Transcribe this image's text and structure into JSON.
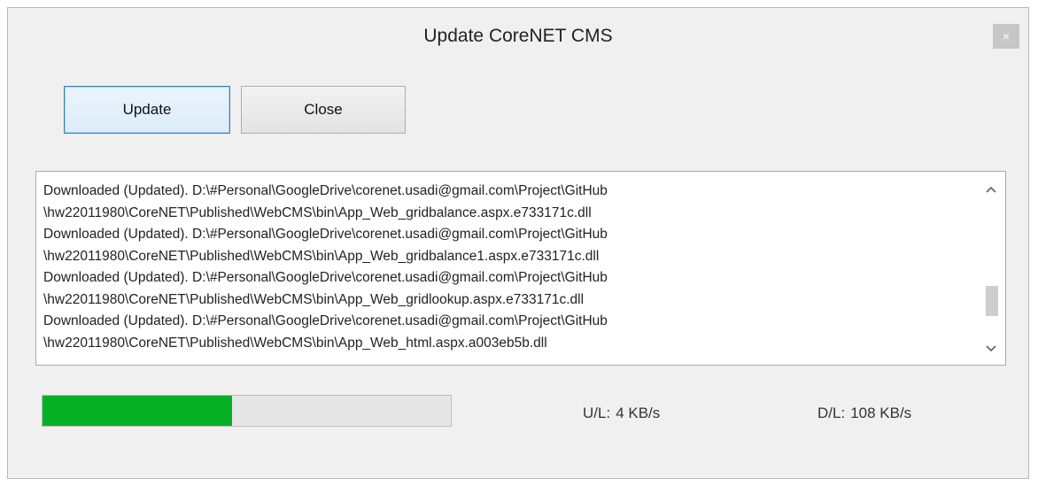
{
  "window": {
    "title": "Update CoreNET CMS",
    "close_glyph": "×"
  },
  "buttons": {
    "update_label": "Update",
    "close_label": "Close"
  },
  "log": {
    "lines": [
      "Downloaded (Updated). D:\\#Personal\\GoogleDrive\\corenet.usadi@gmail.com\\Project\\GitHub",
      "\\hw22011980\\CoreNET\\Published\\WebCMS\\bin\\App_Web_gridbalance.aspx.e733171c.dll",
      "Downloaded (Updated). D:\\#Personal\\GoogleDrive\\corenet.usadi@gmail.com\\Project\\GitHub",
      "\\hw22011980\\CoreNET\\Published\\WebCMS\\bin\\App_Web_gridbalance1.aspx.e733171c.dll",
      "Downloaded (Updated). D:\\#Personal\\GoogleDrive\\corenet.usadi@gmail.com\\Project\\GitHub",
      "\\hw22011980\\CoreNET\\Published\\WebCMS\\bin\\App_Web_gridlookup.aspx.e733171c.dll",
      "Downloaded (Updated). D:\\#Personal\\GoogleDrive\\corenet.usadi@gmail.com\\Project\\GitHub",
      "\\hw22011980\\CoreNET\\Published\\WebCMS\\bin\\App_Web_html.aspx.a003eb5b.dll"
    ],
    "scroll_up_glyph": "^",
    "scroll_down_glyph": "v",
    "scroll_position": 0.82
  },
  "progress": {
    "fraction": 0.465,
    "color": "#06b025"
  },
  "stats": {
    "upload_label": "U/L:",
    "upload_value": "4 KB/s",
    "download_label": "D/L:",
    "download_value": "108 KB/s"
  },
  "icons": {
    "close": "close-icon",
    "scroll_up": "chevron-up-icon",
    "scroll_down": "chevron-down-icon"
  }
}
